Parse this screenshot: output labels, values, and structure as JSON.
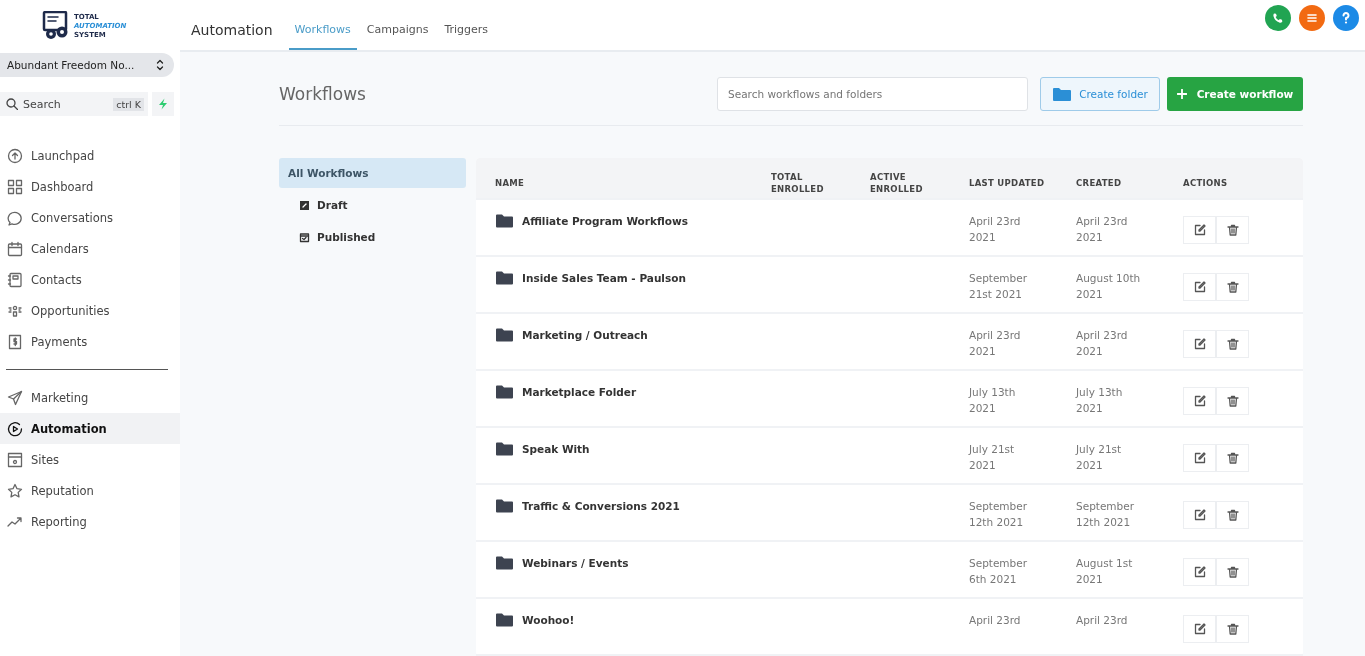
{
  "logo": {
    "line1": "TOTAL",
    "line2": "AUTOMATION",
    "line3": "SYSTEM"
  },
  "account_switcher": {
    "label": "Abundant Freedom No..."
  },
  "search": {
    "label": "Search",
    "shortcut": "ctrl K"
  },
  "nav_groups": [
    {
      "items": [
        {
          "label": "Launchpad",
          "selected": false
        },
        {
          "label": "Dashboard",
          "selected": false
        },
        {
          "label": "Conversations",
          "selected": false
        },
        {
          "label": "Calendars",
          "selected": false
        },
        {
          "label": "Contacts",
          "selected": false
        },
        {
          "label": "Opportunities",
          "selected": false
        },
        {
          "label": "Payments",
          "selected": false
        }
      ]
    },
    {
      "items": [
        {
          "label": "Marketing",
          "selected": false
        },
        {
          "label": "Automation",
          "selected": true
        },
        {
          "label": "Sites",
          "selected": false
        },
        {
          "label": "Reputation",
          "selected": false
        },
        {
          "label": "Reporting",
          "selected": false
        }
      ]
    }
  ],
  "header": {
    "title": "Automation",
    "tabs": [
      {
        "label": "Workflows",
        "selected": true
      },
      {
        "label": "Campaigns",
        "selected": false
      },
      {
        "label": "Triggers",
        "selected": false
      }
    ]
  },
  "top_actions": [
    {
      "kind": "phone",
      "color": "#21a452"
    },
    {
      "kind": "list",
      "color": "#f26a12"
    },
    {
      "kind": "help",
      "color": "#1c8ae6"
    }
  ],
  "page": {
    "title": "Workflows",
    "search_placeholder": "Search workflows and folders",
    "create_folder": "Create folder",
    "create_workflow": "Create workflow"
  },
  "filters": [
    {
      "label": "All Workflows",
      "kind": "all",
      "selected": true
    },
    {
      "label": "Draft",
      "kind": "draft",
      "selected": false
    },
    {
      "label": "Published",
      "kind": "published",
      "selected": false
    }
  ],
  "table": {
    "columns": [
      "NAME",
      "TOTAL ENROLLED",
      "ACTIVE ENROLLED",
      "LAST UPDATED",
      "CREATED",
      "ACTIONS"
    ],
    "rows": [
      {
        "name": "Affiliate Program Workflows",
        "last_updated": "April 23rd 2021",
        "created": "April 23rd 2021"
      },
      {
        "name": "Inside Sales Team - Paulson",
        "last_updated": "September 21st 2021",
        "created": "August 10th 2021"
      },
      {
        "name": "Marketing / Outreach",
        "last_updated": "April 23rd 2021",
        "created": "April 23rd 2021"
      },
      {
        "name": "Marketplace Folder",
        "last_updated": "July 13th 2021",
        "created": "July 13th 2021"
      },
      {
        "name": "Speak With",
        "last_updated": "July 21st 2021",
        "created": "July 21st 2021"
      },
      {
        "name": "Traffic & Conversions 2021",
        "last_updated": "September 12th 2021",
        "created": "September 12th 2021"
      },
      {
        "name": "Webinars / Events",
        "last_updated": "September 6th 2021",
        "created": "August 1st 2021"
      },
      {
        "name": "Woohoo!",
        "last_updated": "April 23rd",
        "created": "April 23rd"
      }
    ]
  }
}
